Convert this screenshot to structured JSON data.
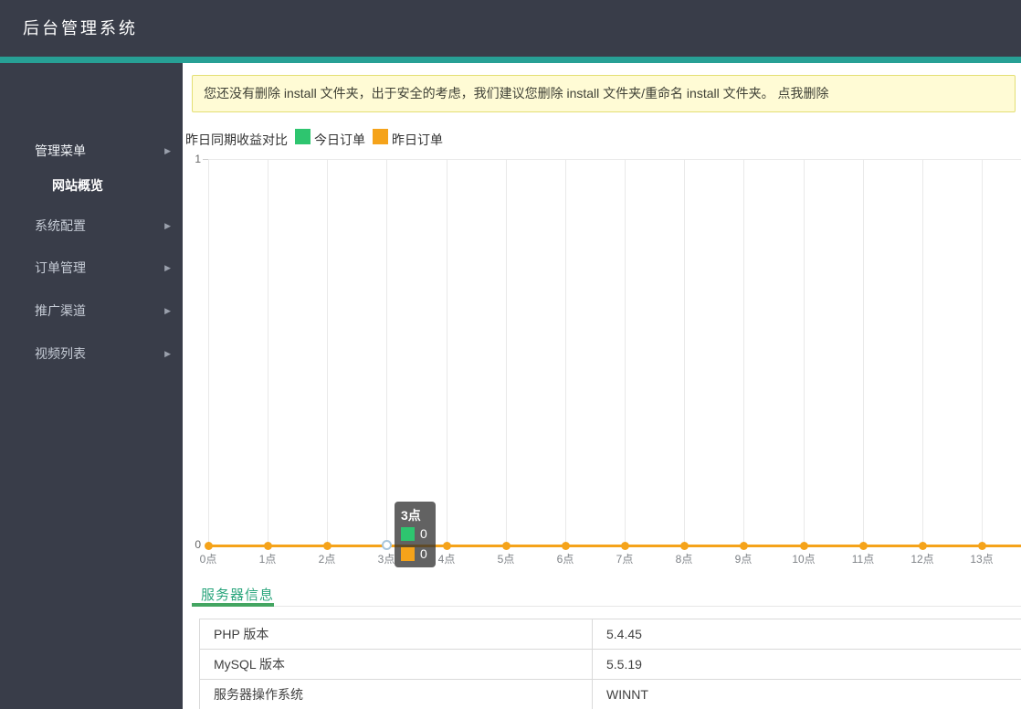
{
  "app": {
    "title": "后台管理系统"
  },
  "colors": {
    "header_bg": "#393d49",
    "accent_teal": "#27a095",
    "banner_bg": "#fffbd5",
    "banner_border": "#e3df74",
    "series_green": "#2ec56f",
    "series_orange": "#f5a31a",
    "tab_text": "#2aa57c",
    "tab_bar": "#43a561"
  },
  "sidebar": {
    "items": [
      {
        "key": "admin-menu",
        "label": "管理菜单",
        "arrow": true,
        "sub": false,
        "open": true
      },
      {
        "key": "site-overview",
        "label": "网站概览",
        "arrow": false,
        "sub": true,
        "open": false
      },
      {
        "key": "system-config",
        "label": "系统配置",
        "arrow": true,
        "sub": false,
        "open": false
      },
      {
        "key": "order-management",
        "label": "订单管理",
        "arrow": true,
        "sub": false,
        "open": false
      },
      {
        "key": "promotion-channel",
        "label": "推广渠道",
        "arrow": true,
        "sub": false,
        "open": false
      },
      {
        "key": "video-list",
        "label": "视频列表",
        "arrow": true,
        "sub": false,
        "open": false
      }
    ]
  },
  "banner": {
    "text": "您还没有删除 install 文件夹，出于安全的考虑，我们建议您删除 install 文件夹/重命名 install 文件夹。 ",
    "link": "点我删除"
  },
  "chart": {
    "legend_label": "昨日同期收益对比",
    "legend": [
      {
        "name": "今日订单",
        "color": "#2ec56f"
      },
      {
        "name": "昨日订单",
        "color": "#f5a31a"
      }
    ],
    "y_ticks": {
      "top": "1",
      "bottom": "0"
    },
    "x_labels": [
      "0点",
      "1点",
      "2点",
      "3点",
      "4点",
      "5点",
      "6点",
      "7点",
      "8点",
      "9点",
      "10点",
      "11点",
      "12点",
      "13点"
    ],
    "hover_index": 3,
    "tooltip": {
      "title": "3点",
      "rows": [
        {
          "color": "#2ec56f",
          "value": "0"
        },
        {
          "color": "#f5a31a",
          "value": "0"
        }
      ]
    }
  },
  "chart_data": {
    "type": "line",
    "title": "昨日同期收益对比",
    "categories": [
      "0点",
      "1点",
      "2点",
      "3点",
      "4点",
      "5点",
      "6点",
      "7点",
      "8点",
      "9点",
      "10点",
      "11点",
      "12点",
      "13点"
    ],
    "series": [
      {
        "name": "今日订单",
        "color": "#2ec56f",
        "values": [
          0,
          0,
          0,
          0,
          0,
          0,
          0,
          0,
          0,
          0,
          0,
          0,
          0,
          0
        ]
      },
      {
        "name": "昨日订单",
        "color": "#f5a31a",
        "values": [
          0,
          0,
          0,
          0,
          0,
          0,
          0,
          0,
          0,
          0,
          0,
          0,
          0,
          0
        ]
      }
    ],
    "ylim": [
      0,
      1
    ],
    "grid": true,
    "legend_position": "top"
  },
  "tabs": {
    "server_info": "服务器信息"
  },
  "server_table": {
    "rows": [
      {
        "label": "PHP 版本",
        "value": "5.4.45"
      },
      {
        "label": "MySQL 版本",
        "value": "5.5.19"
      },
      {
        "label": "服务器操作系统",
        "value": "WINNT"
      }
    ]
  }
}
